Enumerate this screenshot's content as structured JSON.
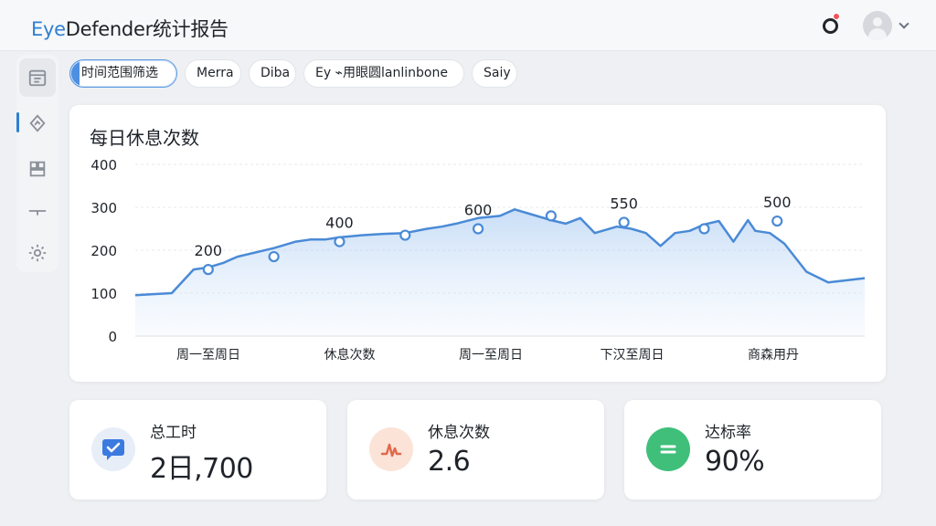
{
  "header": {
    "title_brand": "Eye",
    "title_rest": "Defender统计报告"
  },
  "filters": [
    {
      "label": "时间范围筛选",
      "active": true
    },
    {
      "label": "Merra",
      "active": false
    },
    {
      "label": "Diba",
      "active": false
    },
    {
      "label": "Ey ⌁用眼圆lanlinbone",
      "active": false
    },
    {
      "label": "Saiy",
      "active": false
    }
  ],
  "sidebar": {
    "items": [
      {
        "icon": "calendar-icon",
        "active": true
      },
      {
        "icon": "trend-icon",
        "active": false
      },
      {
        "icon": "report-icon",
        "active": false
      },
      {
        "icon": "divider-icon",
        "active": false
      },
      {
        "icon": "gear-icon",
        "active": false
      }
    ]
  },
  "chart": {
    "title": "每日休息次数"
  },
  "chart_data": {
    "type": "area",
    "title": "每日休息次数",
    "yticks": [
      0,
      100,
      200,
      300,
      400
    ],
    "ylim": [
      0,
      400
    ],
    "x_labels": [
      "周一至周日",
      "休息次数",
      "周一至周日",
      "下汉至周日",
      "商森用丹"
    ],
    "grid": true,
    "color": "#4a8ad6",
    "x": [
      0,
      0.05,
      0.08,
      0.1,
      0.12,
      0.14,
      0.19,
      0.22,
      0.24,
      0.26,
      0.28,
      0.31,
      0.34,
      0.37,
      0.4,
      0.42,
      0.44,
      0.47,
      0.5,
      0.52,
      0.54,
      0.57,
      0.59,
      0.61,
      0.63,
      0.66,
      0.68,
      0.7,
      0.72,
      0.74,
      0.76,
      0.78,
      0.8,
      0.82,
      0.84,
      0.85,
      0.87,
      0.89,
      0.92,
      0.95,
      1.0
    ],
    "values": [
      95,
      100,
      155,
      160,
      170,
      185,
      205,
      220,
      225,
      225,
      230,
      235,
      238,
      240,
      250,
      255,
      262,
      275,
      280,
      295,
      285,
      270,
      262,
      275,
      240,
      255,
      250,
      240,
      210,
      240,
      245,
      260,
      268,
      220,
      270,
      245,
      240,
      215,
      150,
      125,
      135
    ],
    "markers": [
      {
        "x": 0.1,
        "y": 155,
        "label": "200"
      },
      {
        "x": 0.19,
        "y": 185,
        "label": ""
      },
      {
        "x": 0.28,
        "y": 220,
        "label": "400"
      },
      {
        "x": 0.37,
        "y": 235,
        "label": ""
      },
      {
        "x": 0.47,
        "y": 250,
        "label": "600"
      },
      {
        "x": 0.57,
        "y": 280,
        "label": ""
      },
      {
        "x": 0.67,
        "y": 265,
        "label": "550"
      },
      {
        "x": 0.78,
        "y": 250,
        "label": ""
      },
      {
        "x": 0.88,
        "y": 268,
        "label": "500"
      }
    ]
  },
  "stats": [
    {
      "label": "总工时",
      "value": "2日,700",
      "icon": "message-check-icon",
      "bg": "#e8eef8",
      "fg": "#3b7be0"
    },
    {
      "label": "休息次数",
      "value": "2.6",
      "icon": "pulse-icon",
      "bg": "#fbe3d8",
      "fg": "#e06a4a"
    },
    {
      "label": "达标率",
      "value": "90%",
      "icon": "equal-icon",
      "bg": "#3fbf7a",
      "fg": "#ffffff"
    }
  ]
}
